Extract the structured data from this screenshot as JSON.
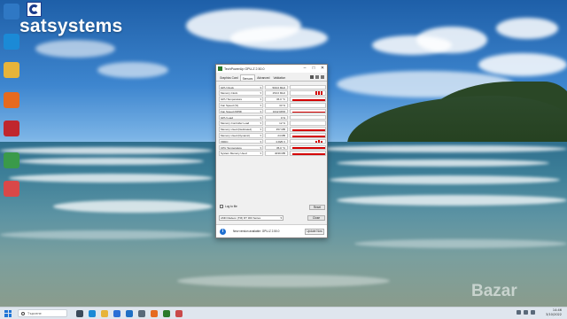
{
  "brand": {
    "site_name": "satsystems",
    "watermark": "Bazar"
  },
  "desktop_icons": [
    {
      "name": "recycle-bin",
      "label": "",
      "color": "#2f78c4"
    },
    {
      "name": "edge",
      "label": "",
      "color": "#1b8ad6"
    },
    {
      "name": "folder",
      "label": "",
      "color": "#e7b43a"
    },
    {
      "name": "firefox",
      "label": "",
      "color": "#e66a1f"
    },
    {
      "name": "aida64",
      "label": "",
      "color": "#c0262e"
    },
    {
      "name": "app",
      "label": "",
      "color": "#3a9a4a"
    },
    {
      "name": "app2",
      "label": "",
      "color": "#d94848"
    }
  ],
  "window": {
    "title": "TechPowerUp GPU-Z 2.50.0",
    "tabs": [
      "Graphics Card",
      "Sensors",
      "Advanced",
      "Validation"
    ],
    "active_tab": "Sensors",
    "sensors": [
      {
        "label": "GPU Clock",
        "value": "500.0 MHz",
        "bars": []
      },
      {
        "label": "Memory Clock",
        "value": "150.0 MHz",
        "bars": [
          0.9,
          0.9,
          0.9
        ]
      },
      {
        "label": "GPU Temperature",
        "value": "36.0 °C",
        "bars": [
          0.5
        ]
      },
      {
        "label": "Fan Speed (%)",
        "value": "33 %",
        "bars": []
      },
      {
        "label": "Fan Speed (RPM)",
        "value": "1642 RPM",
        "bars": [
          0.4
        ]
      },
      {
        "label": "GPU Load",
        "value": "0 %",
        "bars": []
      },
      {
        "label": "Memory Controller Load",
        "value": "12 %",
        "bars": []
      },
      {
        "label": "Memory Used (Dedicated)",
        "value": "357 MB",
        "bars": [
          0.35
        ]
      },
      {
        "label": "Memory Used (Dynamic)",
        "value": "24 MB",
        "bars": [
          0.3
        ]
      },
      {
        "label": "VDDC",
        "value": "0.825 V",
        "bars": [
          0.6,
          0.7,
          0.6
        ]
      },
      {
        "label": "CPU Temperature",
        "value": "35.0 °C",
        "bars": [
          0.5
        ]
      },
      {
        "label": "System Memory Used",
        "value": "4039 MB",
        "bars": [
          0.5
        ]
      }
    ],
    "log_to_file": "Log to file",
    "reset_button": "Reset",
    "gpu_select": "AMD Radeon (TM) RT 300 Series",
    "close_button": "Close",
    "notice_text": "New version available: GPU-Z 2.50.0",
    "update_button": "Update Now"
  },
  "taskbar": {
    "search_placeholder": "Търсене",
    "time": "14:46",
    "date": "3/10/2022",
    "icons": [
      "task-view",
      "edge",
      "explorer",
      "store",
      "mail",
      "app",
      "firefox",
      "gpuz",
      "app"
    ]
  }
}
